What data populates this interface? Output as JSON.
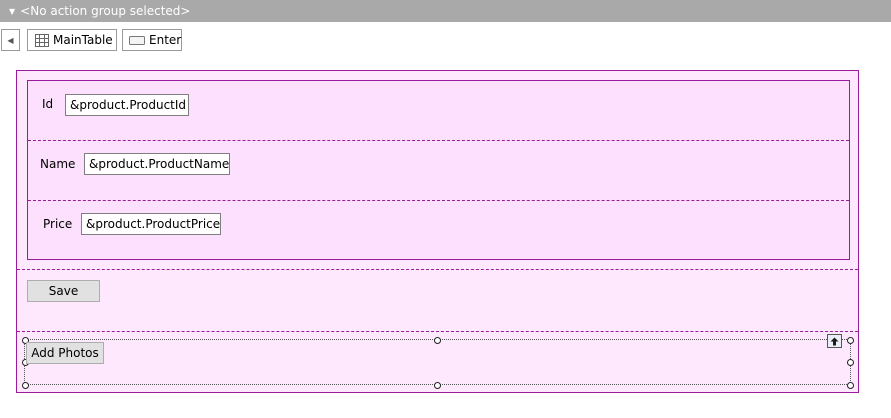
{
  "top_bar": {
    "text": "<No action group selected>",
    "caret_icon": "triangle-down-icon"
  },
  "toolbar": {
    "back_icon": "triangle-left-icon",
    "main_table_label": "MainTable",
    "main_table_icon": "grid-icon",
    "enter_label": "Enter",
    "enter_icon": "textbox-icon"
  },
  "form": {
    "fields": [
      {
        "label": "Id",
        "value": "&product.ProductId"
      },
      {
        "label": "Name",
        "value": "&product.ProductName"
      },
      {
        "label": "Price",
        "value": "&product.ProductPrice"
      }
    ],
    "save_label": "Save",
    "add_photos_label": "Add Photos"
  },
  "colors": {
    "top_bar": "#a9a9a9",
    "frame": "#9b1c9b",
    "panel": "#fde8fd",
    "button": "#e1e1e1"
  }
}
